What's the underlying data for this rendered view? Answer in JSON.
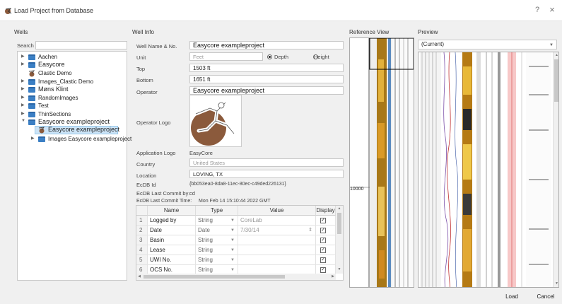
{
  "window": {
    "title": "Load Project from Database",
    "help": "?",
    "close": "×"
  },
  "wells": {
    "section": "Wells",
    "search_label": "Search",
    "search_value": "",
    "items": [
      {
        "label": "Aachen",
        "expand": "▶"
      },
      {
        "label": "Easycore",
        "expand": "▶"
      },
      {
        "label": "Clastic Demo",
        "expand": ""
      },
      {
        "label": "Images_Clastic Demo",
        "expand": "▶"
      },
      {
        "label": "Møns Klint",
        "expand": "▶"
      },
      {
        "label": "RandomImages",
        "expand": "▶"
      },
      {
        "label": "Test",
        "expand": "▶"
      },
      {
        "label": "ThinSections",
        "expand": "▶"
      },
      {
        "label": "Easycore exampleproject",
        "expand": "▼"
      },
      {
        "label": "Easycore exampleproject",
        "expand": ""
      },
      {
        "label": "Images Easycore exampleproject",
        "expand": "▶"
      }
    ]
  },
  "well_info": {
    "section": "Well Info",
    "fields": {
      "name": {
        "label": "Well Name & No.",
        "value": "Easycore exampleproject"
      },
      "unit": {
        "label": "Unit",
        "value": "Feet",
        "opt_depth": "Depth",
        "opt_height": "Height"
      },
      "top": {
        "label": "Top",
        "value": "1503 ft"
      },
      "bottom": {
        "label": "Bottom",
        "value": "1651 ft"
      },
      "operator": {
        "label": "Operator",
        "value": "Easycore exampleproject"
      },
      "operator_logo": {
        "label": "Operator Logo"
      },
      "app_logo": {
        "label": "Application Logo",
        "value": "EasyCore"
      },
      "country": {
        "label": "Country",
        "value": "United States"
      },
      "location": {
        "label": "Location",
        "value": "LOVING, TX"
      },
      "ecdb_id": {
        "label": "EcDB Id",
        "value": "{bb053ea0-8da8-11ec-80ec-c49ded226131}"
      },
      "last_commit_by": {
        "label": "EcDB Last Commit by:",
        "value": "cd"
      },
      "last_commit_time": {
        "label": "EcDB Last Commit Time:",
        "value": "Mon Feb 14 15:10:44 2022 GMT"
      }
    },
    "table": {
      "headers": [
        "Name",
        "Type",
        "Value",
        "Display"
      ],
      "rows": [
        {
          "n": "1",
          "name": "Logged by",
          "type": "String",
          "value": "CoreLab",
          "display": "✓"
        },
        {
          "n": "2",
          "name": "Date",
          "type": "Date",
          "value": "7/30/14",
          "display": "✓"
        },
        {
          "n": "3",
          "name": "Basin",
          "type": "String",
          "value": "",
          "display": "✓"
        },
        {
          "n": "4",
          "name": "Lease",
          "type": "String",
          "value": "",
          "display": "✓"
        },
        {
          "n": "5",
          "name": "UWI No.",
          "type": "String",
          "value": "",
          "display": "✓"
        },
        {
          "n": "6",
          "name": "OCS No.",
          "type": "String",
          "value": "",
          "display": "✓"
        }
      ]
    }
  },
  "reference_view": {
    "section": "Reference View",
    "depth_label": "10000"
  },
  "preview": {
    "section": "Preview",
    "selected": "(Current)"
  },
  "buttons": {
    "load": "Load",
    "cancel": "Cancel"
  },
  "colors": {
    "accent": "#3b7fc4",
    "selection": "#cce4f7",
    "logo": "#8b5a3c"
  }
}
